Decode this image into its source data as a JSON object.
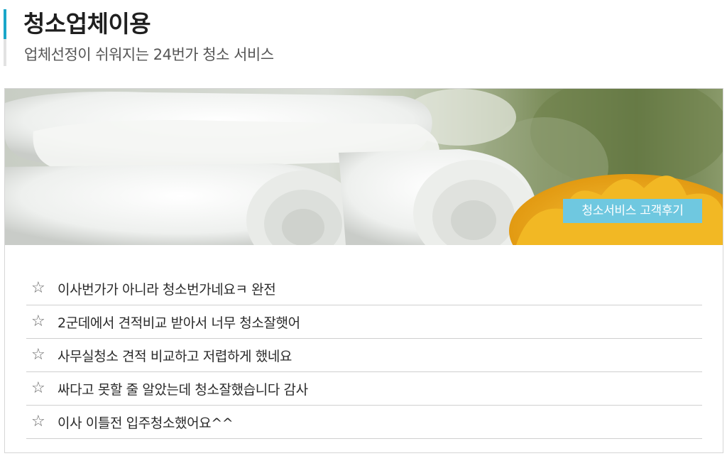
{
  "header": {
    "title": "청소업체이용",
    "subtitle": "업체선정이 쉬워지는 24번가 청소 서비스"
  },
  "banner": {
    "image": "towels-and-yellow-flower",
    "tag_label": "청소서비스 고객후기",
    "tag_color": "#6fc8e0"
  },
  "reviews": {
    "icon": "star-outline-icon",
    "items": [
      {
        "text": " 이사번가가 아니라 청소번가네요ㅋ 완전"
      },
      {
        "text": "2군데에서 견적비교 받아서 너무 청소잘햇어"
      },
      {
        "text": "사무실청소 견적 비교하고 저렵하게 했네요"
      },
      {
        "text": "싸다고 못할 줄 알았는데 청소잘했습니다 감사"
      },
      {
        "text": "이사 이틀전 입주청소했어요^^"
      }
    ]
  },
  "colors": {
    "accent": "#1aa6c9",
    "divider": "#cfcfcf"
  }
}
